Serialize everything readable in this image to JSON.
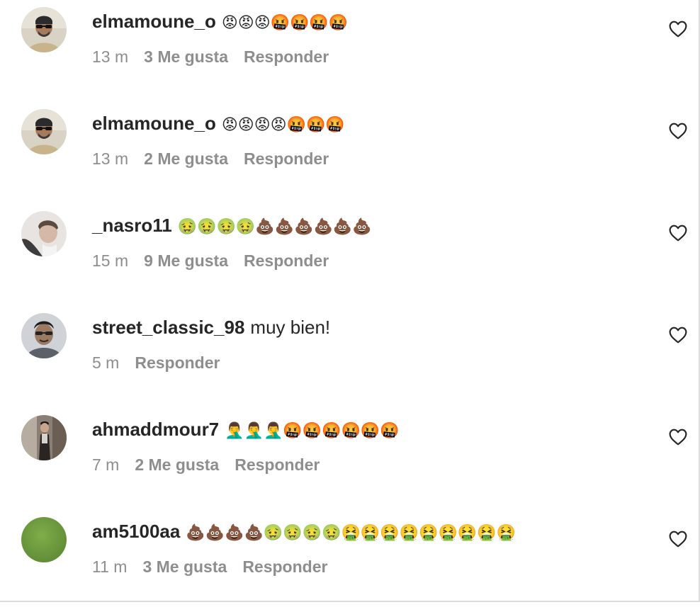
{
  "comments": [
    {
      "username": "elmamoune_o",
      "text": "😡😡😡🤬🤬🤬🤬",
      "time": "13 m",
      "likes": "3 Me gusta",
      "reply": "Responder",
      "avatar_color": "#c9b58e"
    },
    {
      "username": "elmamoune_o",
      "text": "😡😡😡😡🤬🤬🤬",
      "time": "13 m",
      "likes": "2 Me gusta",
      "reply": "Responder",
      "avatar_color": "#c9b58e"
    },
    {
      "username": "_nasro11",
      "text": "🤢🤢🤢🤢💩💩💩💩💩💩",
      "time": "15 m",
      "likes": "9 Me gusta",
      "reply": "Responder",
      "avatar_color": "#b9a9a4"
    },
    {
      "username": "street_classic_98",
      "text": "muy bien!",
      "time": "5 m",
      "likes": "",
      "reply": "Responder",
      "avatar_color": "#8b8f9a"
    },
    {
      "username": "ahmaddmour7",
      "text": "🤦‍♂️🤦‍♂️🤦‍♂️🤬🤬🤬🤬🤬🤬",
      "time": "7 m",
      "likes": "2 Me gusta",
      "reply": "Responder",
      "avatar_color": "#5a4a40"
    },
    {
      "username": "am5100aa",
      "text": "💩💩💩💩🤢🤢🤢🤢🤮🤮🤮🤮🤮🤮🤮🤮🤮",
      "time": "11 m",
      "likes": "3 Me gusta",
      "reply": "Responder",
      "avatar_color": "#6e9a3e"
    }
  ],
  "icons": {
    "like": "heart-outline-icon"
  }
}
